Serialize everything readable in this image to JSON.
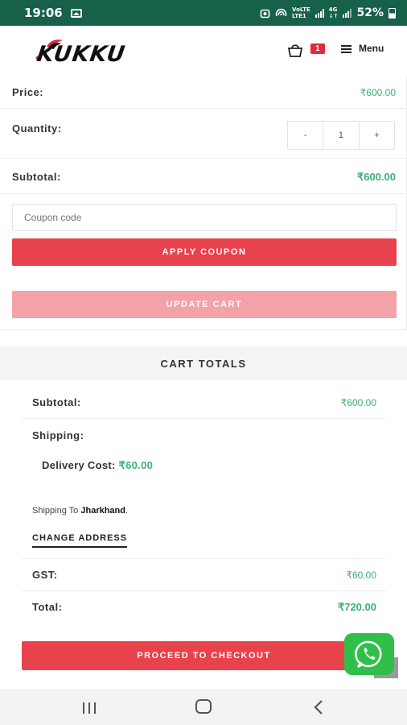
{
  "status_bar": {
    "time": "19:06",
    "carrier_1_top": "VoLTE",
    "carrier_1_bottom": "LTE1",
    "carrier_2_top": "4G",
    "carrier_2_bottom": "↓↑",
    "battery": "52%"
  },
  "header": {
    "logo_text": "KUKKU",
    "cart_count": "1",
    "menu_label": "Menu"
  },
  "cart_item": {
    "price_label": "Price:",
    "price_value": "₹600.00",
    "quantity_label": "Quantity:",
    "quantity_minus": "-",
    "quantity_value": "1",
    "quantity_plus": "+",
    "subtotal_label": "Subtotal:",
    "subtotal_value": "₹600.00"
  },
  "coupon": {
    "placeholder": "Coupon code",
    "apply_label": "APPLY COUPON",
    "update_label": "UPDATE CART"
  },
  "cart_totals": {
    "heading": "CART TOTALS",
    "subtotal_label": "Subtotal:",
    "subtotal_value": "₹600.00",
    "shipping_label": "Shipping:",
    "delivery_label": "Delivery Cost:",
    "delivery_value": "₹60.00",
    "shipping_to_prefix": "Shipping To",
    "shipping_to_state": "Jharkhand",
    "shipping_to_suffix": ".",
    "change_address_label": "CHANGE ADDRESS",
    "gst_label": "GST:",
    "gst_value": "₹60.00",
    "total_label": "Total:",
    "total_value": "₹720.00",
    "checkout_label": "PROCEED TO CHECKOUT"
  },
  "colors": {
    "status_bar": "#17604a",
    "accent_red": "#e8424d",
    "disabled_pink": "#f3a2a8",
    "price_green": "#3bb273",
    "whatsapp_green": "#2fbf4a"
  },
  "icons": [
    "gallery-icon",
    "signal-icon",
    "battery-icon",
    "cart-icon",
    "hamburger-menu-icon",
    "whatsapp-icon",
    "scroll-to-top-icon",
    "nav-recents-icon",
    "nav-home-icon",
    "nav-back-icon"
  ]
}
